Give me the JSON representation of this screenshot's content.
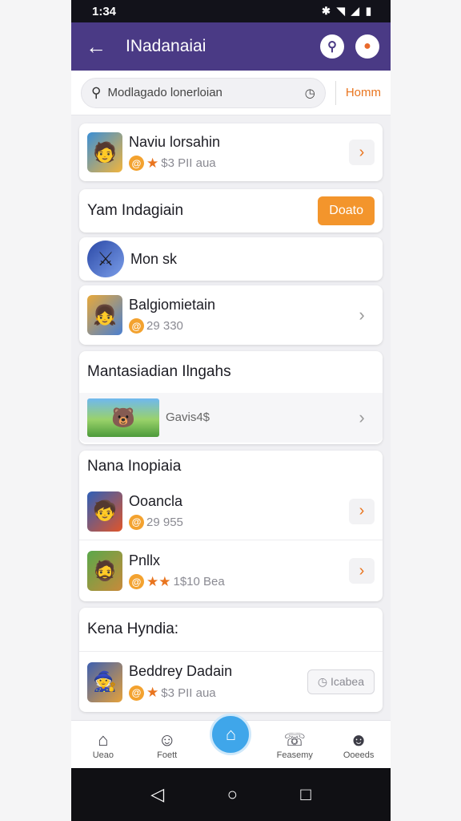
{
  "status": {
    "time": "1:34",
    "icons": [
      "bluetooth-icon",
      "wifi-icon",
      "signal-icon",
      "battery-icon"
    ]
  },
  "appbar": {
    "title": "INadanaiai",
    "back_icon": "arrow-left-icon",
    "search_icon": "search-icon",
    "notify_icon": "notification-icon"
  },
  "search": {
    "placeholder": "Modlagado lonerloian",
    "link": "Homm"
  },
  "cards": {
    "top": {
      "name": "Naviu lorsahin",
      "meta": "$3 PII aua"
    },
    "section1": {
      "title": "Yam Indagiain",
      "button": "Doato"
    },
    "item_mon": {
      "name": "Mon sk"
    },
    "item_bal": {
      "name": "Balgiomietain",
      "meta": "29 330"
    },
    "section2": {
      "title": "Mantasiadian Ilngahs",
      "row": "Gavis4$"
    },
    "section3": {
      "title": "Nana Inopiaia",
      "items": [
        {
          "name": "Ooancla",
          "meta": "29 955"
        },
        {
          "name": "Pnllx",
          "meta": "1$10 Bea"
        }
      ]
    },
    "section4": {
      "title": "Kena Hyndia:",
      "item": {
        "name": "Beddrey Dadain",
        "meta": "$3 PII aua",
        "button": "Icabea"
      }
    }
  },
  "bottom_nav": {
    "items": [
      {
        "label": "Ueao",
        "icon": "home-icon"
      },
      {
        "label": "Foett",
        "icon": "chat-icon"
      },
      {
        "label": "",
        "icon": "center-home-icon"
      },
      {
        "label": "Feasemy",
        "icon": "message-icon"
      },
      {
        "label": "Ooeeds",
        "icon": "profile-icon"
      }
    ]
  },
  "colors": {
    "appbar": "#4a3a85",
    "accent": "#e9751f",
    "nav_center": "#3fa6ea"
  }
}
